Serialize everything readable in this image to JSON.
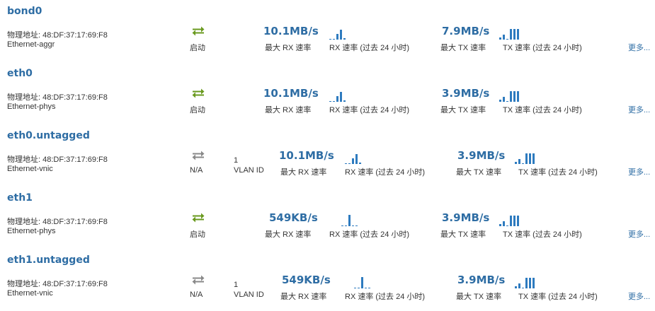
{
  "colors": {
    "accent": "#2e6da4",
    "bar": "#2e7bbf",
    "status_up": "#6a9a1f",
    "status_na": "#8a8a8a"
  },
  "icons": {
    "up": "green-transfer-arrows-icon",
    "na": "gray-transfer-arrows-icon"
  },
  "interfaces": [
    {
      "name": "bond0",
      "mac": "物理地址: 48:DF:37:17:69:F8",
      "type": "Ethernet-aggr",
      "status": "启动",
      "status_state": "up",
      "vlan_id": "",
      "vlan_label": "",
      "rx_max": "10.1MB/s",
      "rx_max_label": "最大 RX 速率",
      "rx_chart_label": "RX 速率 (过去 24 小时)",
      "tx_max": "7.9MB/s",
      "tx_max_label": "最大 TX 速率",
      "tx_chart_label": "TX 速率 (过去 24 小时)",
      "rx_spark": [
        0.05,
        0,
        0.45,
        0.8,
        0.1
      ],
      "tx_spark": [
        0.15,
        0.4,
        0.05,
        0.85,
        0.85,
        0.85
      ],
      "more": "更多..."
    },
    {
      "name": "eth0",
      "mac": "物理地址: 48:DF:37:17:69:F8",
      "type": "Ethernet-phys",
      "status": "启动",
      "status_state": "up",
      "vlan_id": "",
      "vlan_label": "",
      "rx_max": "10.1MB/s",
      "rx_max_label": "最大 RX 速率",
      "rx_chart_label": "RX 速率 (过去 24 小时)",
      "tx_max": "3.9MB/s",
      "tx_max_label": "最大 TX 速率",
      "tx_chart_label": "TX 速率 (过去 24 小时)",
      "rx_spark": [
        0.05,
        0,
        0.45,
        0.8,
        0.1
      ],
      "tx_spark": [
        0.15,
        0.4,
        0.05,
        0.85,
        0.85,
        0.85
      ],
      "more": "更多..."
    },
    {
      "name": "eth0.untagged",
      "mac": "物理地址: 48:DF:37:17:69:F8",
      "type": "Ethernet-vnic",
      "status": "N/A",
      "status_state": "na",
      "vlan_id": "1",
      "vlan_label": "VLAN ID",
      "rx_max": "10.1MB/s",
      "rx_max_label": "最大 RX 速率",
      "rx_chart_label": "RX 速率 (过去 24 小时)",
      "tx_max": "3.9MB/s",
      "tx_max_label": "最大 TX 速率",
      "tx_chart_label": "TX 速率 (过去 24 小时)",
      "rx_spark": [
        0.05,
        0,
        0.45,
        0.8,
        0.1
      ],
      "tx_spark": [
        0.15,
        0.4,
        0.05,
        0.85,
        0.85,
        0.85
      ],
      "more": "更多..."
    },
    {
      "name": "eth1",
      "mac": "物理地址: 48:DF:37:17:69:F8",
      "type": "Ethernet-phys",
      "status": "启动",
      "status_state": "up",
      "vlan_id": "",
      "vlan_label": "",
      "rx_max": "549KB/s",
      "rx_max_label": "最大 RX 速率",
      "rx_chart_label": "RX 速率 (过去 24 小时)",
      "tx_max": "3.9MB/s",
      "tx_max_label": "最大 TX 速率",
      "tx_chart_label": "TX 速率 (过去 24 小时)",
      "rx_spark": [
        0,
        0,
        0.9,
        0,
        0
      ],
      "tx_spark": [
        0.15,
        0.4,
        0.05,
        0.85,
        0.85,
        0.85
      ],
      "more": "更多..."
    },
    {
      "name": "eth1.untagged",
      "mac": "物理地址: 48:DF:37:17:69:F8",
      "type": "Ethernet-vnic",
      "status": "N/A",
      "status_state": "na",
      "vlan_id": "1",
      "vlan_label": "VLAN ID",
      "rx_max": "549KB/s",
      "rx_max_label": "最大 RX 速率",
      "rx_chart_label": "RX 速率 (过去 24 小时)",
      "tx_max": "3.9MB/s",
      "tx_max_label": "最大 TX 速率",
      "tx_chart_label": "TX 速率 (过去 24 小时)",
      "rx_spark": [
        0,
        0,
        0.9,
        0,
        0
      ],
      "tx_spark": [
        0.15,
        0.4,
        0.05,
        0.85,
        0.85,
        0.85
      ],
      "more": "更多..."
    }
  ]
}
